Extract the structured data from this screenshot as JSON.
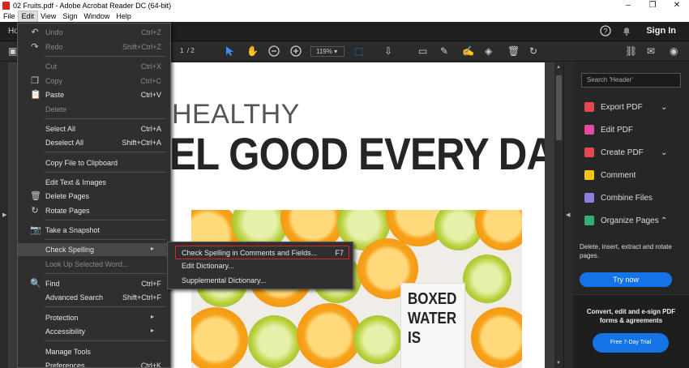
{
  "window": {
    "title": "02 Fruits.pdf - Adobe Acrobat Reader DC (64-bit)",
    "minimize": "–",
    "restore": "❐",
    "close": "✕"
  },
  "menubar": [
    "File",
    "Edit",
    "View",
    "Sign",
    "Window",
    "Help"
  ],
  "topnav": {
    "home": "Ho",
    "sign_in": "Sign In"
  },
  "toolbar": {
    "page_current": "1",
    "page_total": "/ 2",
    "zoom": "119%"
  },
  "edit_menu": {
    "undo": {
      "label": "Undo",
      "shortcut": "Ctrl+Z"
    },
    "redo": {
      "label": "Redo",
      "shortcut": "Shift+Ctrl+Z"
    },
    "cut": {
      "label": "Cut",
      "shortcut": "Ctrl+X"
    },
    "copy": {
      "label": "Copy",
      "shortcut": "Ctrl+C"
    },
    "paste": {
      "label": "Paste",
      "shortcut": "Ctrl+V"
    },
    "delete": {
      "label": "Delete"
    },
    "select_all": {
      "label": "Select All",
      "shortcut": "Ctrl+A"
    },
    "deselect_all": {
      "label": "Deselect All",
      "shortcut": "Shift+Ctrl+A"
    },
    "copy_clipboard": {
      "label": "Copy File to Clipboard"
    },
    "edit_text": {
      "label": "Edit Text & Images"
    },
    "delete_pages": {
      "label": "Delete Pages"
    },
    "rotate_pages": {
      "label": "Rotate Pages"
    },
    "snapshot": {
      "label": "Take a Snapshot"
    },
    "check_spelling": {
      "label": "Check Spelling"
    },
    "look_up": {
      "label": "Look Up Selected Word..."
    },
    "find": {
      "label": "Find",
      "shortcut": "Ctrl+F"
    },
    "advanced_search": {
      "label": "Advanced Search",
      "shortcut": "Shift+Ctrl+F"
    },
    "protection": {
      "label": "Protection"
    },
    "accessibility": {
      "label": "Accessibility"
    },
    "manage_tools": {
      "label": "Manage Tools"
    },
    "preferences": {
      "label": "Preferences...",
      "shortcut": "Ctrl+K"
    }
  },
  "spelling_submenu": {
    "check_in_comments": {
      "label": "Check Spelling in Comments and Fields...",
      "shortcut": "F7"
    },
    "edit_dictionary": {
      "label": "Edit Dictionary..."
    },
    "supplemental": {
      "label": "Supplemental Dictionary..."
    }
  },
  "document": {
    "headline_small": "HEALTHY",
    "headline_big": "EL GOOD EVERY DAY",
    "carton_text": [
      "BOXED",
      "WATER",
      "IS"
    ]
  },
  "right_pane": {
    "search_placeholder": "Search 'Header'",
    "tools": [
      {
        "label": "Export PDF",
        "color": "#e34850"
      },
      {
        "label": "Edit PDF",
        "color": "#e34c9e"
      },
      {
        "label": "Create PDF",
        "color": "#e34850"
      },
      {
        "label": "Comment",
        "color": "#f5c518"
      },
      {
        "label": "Combine Files",
        "color": "#8f7ee0"
      },
      {
        "label": "Organize Pages",
        "color": "#2fb36c"
      }
    ],
    "organize_desc": "Delete, insert, extract and rotate pages.",
    "try_now": "Try now",
    "promo_text": "Convert, edit and e-sign PDF forms & agreements",
    "promo_button": "Free 7-Day Trial"
  }
}
